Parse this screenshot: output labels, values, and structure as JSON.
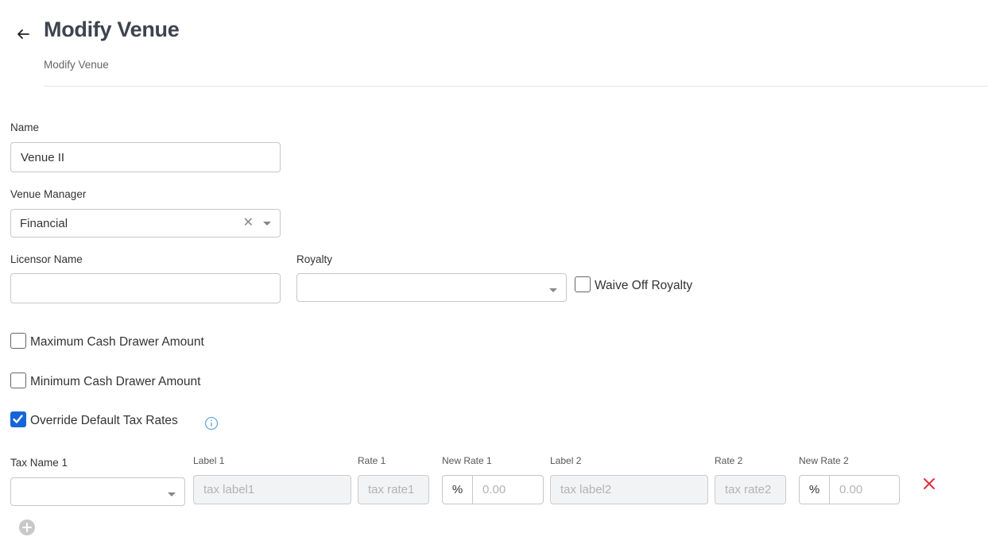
{
  "header": {
    "title": "Modify Venue",
    "subtitle": "Modify Venue"
  },
  "form": {
    "name_label": "Name",
    "name_value": "Venue II",
    "venue_manager_label": "Venue Manager",
    "venue_manager_value": "Financial",
    "licensor_label": "Licensor Name",
    "licensor_value": "",
    "royalty_label": "Royalty",
    "royalty_value": "",
    "waive_royalty_label": "Waive Off Royalty",
    "waive_royalty_checked": false,
    "max_cash_label": "Maximum Cash Drawer Amount",
    "max_cash_checked": false,
    "min_cash_label": "Minimum Cash Drawer Amount",
    "min_cash_checked": false,
    "override_tax_label": "Override Default Tax Rates",
    "override_tax_checked": true
  },
  "tax_row": {
    "tax_name_label": "Tax Name 1",
    "tax_name_value": "",
    "label1_header": "Label 1",
    "label1_placeholder": "tax label1",
    "rate1_header": "Rate 1",
    "rate1_placeholder": "tax rate1",
    "new_rate1_header": "New Rate 1",
    "new_rate1_addon": "%",
    "new_rate1_placeholder": "0.00",
    "label2_header": "Label 2",
    "label2_placeholder": "tax label2",
    "rate2_header": "Rate 2",
    "rate2_placeholder": "tax rate2",
    "new_rate2_header": "New Rate 2",
    "new_rate2_addon": "%",
    "new_rate2_placeholder": "0.00"
  },
  "icons": {
    "back": "arrow-left-icon",
    "clear": "close-icon",
    "dropdown": "chevron-down-icon",
    "info": "info-icon",
    "remove": "close-icon",
    "add": "plus-circle-icon"
  },
  "colors": {
    "accent": "#1565d8",
    "danger": "#e2313d",
    "info": "#6aa9d8",
    "title": "#3d4450"
  }
}
